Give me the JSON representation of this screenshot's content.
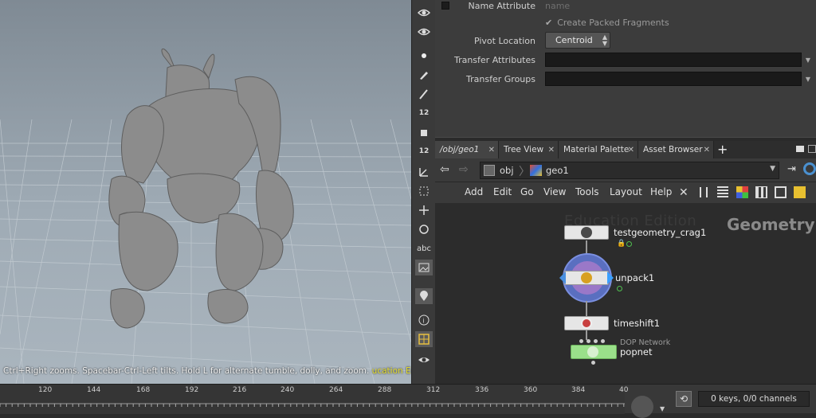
{
  "viewport": {
    "hint_main": "Ctrl+Right zooms. Spacebar-Ctrl-Left tilts. Hold L for alternate tumble, dolly, and zoom.",
    "hint_edu": "ucation Edition"
  },
  "toolstrip": {
    "snap_count_1": "12",
    "snap_count_2": "12",
    "text_tool": "abc"
  },
  "params": {
    "name_attribute_label": "Name Attribute",
    "name_attribute_placeholder": "name",
    "create_packed_label": "Create Packed Fragments",
    "pivot_location_label": "Pivot Location",
    "pivot_location_value": "Centroid",
    "transfer_attributes_label": "Transfer Attributes",
    "transfer_groups_label": "Transfer Groups"
  },
  "tabs": [
    {
      "label": "/obj/geo1"
    },
    {
      "label": "Tree View"
    },
    {
      "label": "Material Palette"
    },
    {
      "label": "Asset Browser"
    }
  ],
  "path": {
    "seg1": "obj",
    "seg2": "geo1"
  },
  "menu": [
    "Add",
    "Edit",
    "Go",
    "View",
    "Tools",
    "Layout",
    "Help"
  ],
  "network": {
    "watermark_edu": "Education Edition",
    "watermark_context": "Geometry",
    "nodes": [
      {
        "name": "testgeometry_crag1"
      },
      {
        "name": "unpack1"
      },
      {
        "name": "timeshift1"
      },
      {
        "name": "popnet",
        "type_label": "DOP Network"
      }
    ]
  },
  "timeline": {
    "ticks": [
      "120",
      "144",
      "168",
      "192",
      "216",
      "240",
      "264",
      "288",
      "312",
      "336",
      "360",
      "384",
      "40"
    ],
    "keys_status": "0 keys, 0/0 channels"
  }
}
